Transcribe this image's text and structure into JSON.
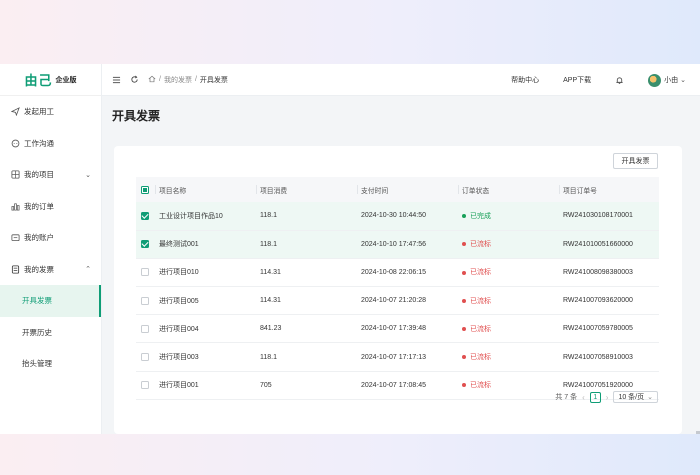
{
  "brand": {
    "logo_mark": "由己",
    "logo_sub": "企业版"
  },
  "sidebar": {
    "items": [
      {
        "label": "发起用工"
      },
      {
        "label": "工作沟通"
      },
      {
        "label": "我的项目"
      },
      {
        "label": "我的订单"
      },
      {
        "label": "我的账户"
      },
      {
        "label": "我的发票"
      },
      {
        "label": "开具发票"
      },
      {
        "label": "开票历史"
      },
      {
        "label": "抬头管理"
      }
    ]
  },
  "topbar": {
    "breadcrumb": [
      "我的发票",
      "开具发票"
    ],
    "help": "帮助中心",
    "app": "APP下载",
    "user": "小由"
  },
  "page": {
    "title": "开具发票",
    "issue_button": "开具发票"
  },
  "table": {
    "columns": [
      "项目名称",
      "项目消费",
      "支付时间",
      "订单状态",
      "项目订单号"
    ],
    "rows": [
      {
        "checked": true,
        "name": "工业设计项目作品10",
        "amount": "118.1",
        "time": "2024-10-30 10:44:50",
        "status": "已完成",
        "order": "RW241030108170001"
      },
      {
        "checked": true,
        "name": "最终测试001",
        "amount": "118.1",
        "time": "2024-10-10 17:47:56",
        "status": "已流标",
        "order": "RW241010051660000"
      },
      {
        "checked": false,
        "name": "进行项目010",
        "amount": "114.31",
        "time": "2024-10-08 22:06:15",
        "status": "已流标",
        "order": "RW241008098380003"
      },
      {
        "checked": false,
        "name": "进行项目005",
        "amount": "114.31",
        "time": "2024-10-07 21:20:28",
        "status": "已流标",
        "order": "RW241007093620000"
      },
      {
        "checked": false,
        "name": "进行项目004",
        "amount": "841.23",
        "time": "2024-10-07 17:39:48",
        "status": "已流标",
        "order": "RW241007059780005"
      },
      {
        "checked": false,
        "name": "进行项目003",
        "amount": "118.1",
        "time": "2024-10-07 17:17:13",
        "status": "已流标",
        "order": "RW241007058910003"
      },
      {
        "checked": false,
        "name": "进行项目001",
        "amount": "705",
        "time": "2024-10-07 17:08:45",
        "status": "已流标",
        "order": "RW241007051920000"
      }
    ]
  },
  "pagination": {
    "total": "共 7 条",
    "current": "1",
    "page_size": "10 条/页"
  },
  "colors": {
    "accent": "#0f9d76",
    "status_done": "#18a058",
    "status_failed": "#e04f4f"
  }
}
